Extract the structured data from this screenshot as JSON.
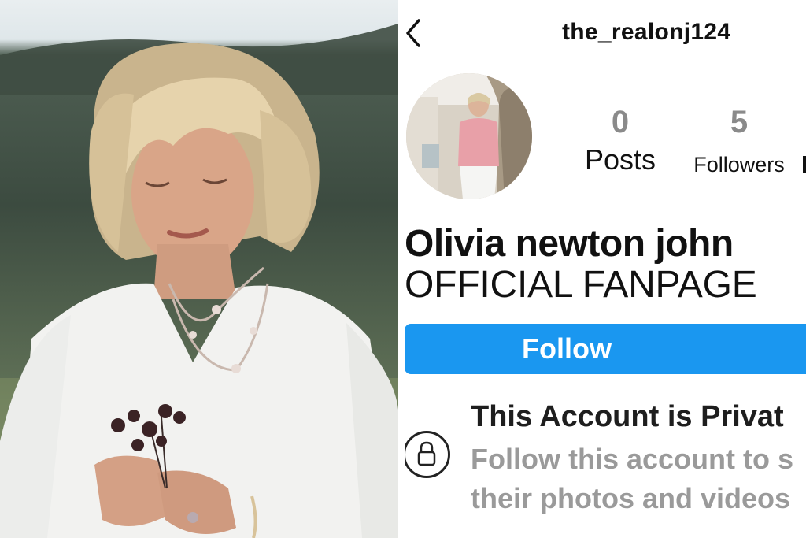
{
  "profile": {
    "username": "the_realonj124",
    "display_name": "Olivia newton john",
    "bio": "OFFICIAL FANPAGE"
  },
  "stats": {
    "posts": {
      "value": "0",
      "label": "Posts"
    },
    "followers": {
      "value": "5",
      "label": "Followers"
    }
  },
  "actions": {
    "follow_label": "Follow"
  },
  "private_notice": {
    "title": "This Account is Privat",
    "line1": "Follow this account to s",
    "line2": "their photos and videos"
  },
  "icons": {
    "back": "chevron-left-icon",
    "lock": "lock-icon"
  },
  "colors": {
    "follow_button": "#1a97f0",
    "stat_number": "#8a8a8a",
    "muted_text": "#9a9a9a"
  }
}
